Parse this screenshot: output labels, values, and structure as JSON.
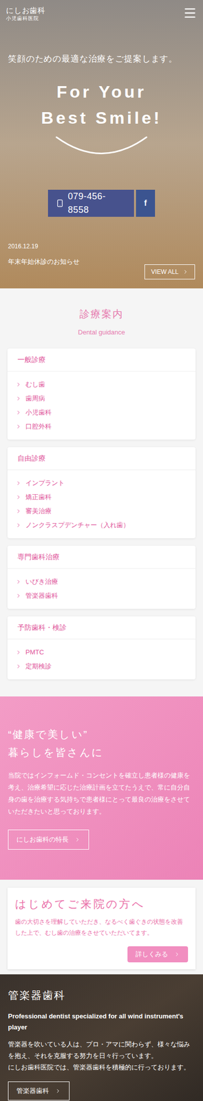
{
  "header": {
    "logo": "にしお歯科",
    "logo_sub": "小児歯科医院"
  },
  "hero": {
    "tagline": "笑顔のための最適な治療をご提案します。",
    "title_lines": [
      "For Your",
      "Best Smile!"
    ],
    "phone": "079-456-8558",
    "facebook": "f"
  },
  "news": {
    "date": "2016.12.19",
    "title": "年末年始休診のお知らせ",
    "button": "VIEW ALL"
  },
  "guidance": {
    "title": "診療案内",
    "subtitle": "Dental guidance",
    "cards": [
      {
        "title": "一般診療",
        "items": [
          "むし歯",
          "歯周病",
          "小児歯科",
          "口腔外科"
        ]
      },
      {
        "title": "自由診療",
        "items": [
          "インプラント",
          "矯正歯科",
          "審美治療",
          "ノンクラスプデンチャー（入れ歯）"
        ]
      },
      {
        "title": "専門歯科治療",
        "items": [
          "いびき治療",
          "管楽器歯科"
        ]
      },
      {
        "title": "予防歯科・検診",
        "items": [
          "PMTC",
          "定期検診"
        ]
      }
    ]
  },
  "feature": {
    "title_lines": [
      "“健康で美しい”",
      "暮らしを皆さんに"
    ],
    "text": "当院ではインフォームド・コンセントを確立し患者様の健康を考え、治療希望に応じた治療計画を立てたうえで、常に自分自身の歯を治療する気持ちで患者様にとって最良の治療をさせていただきたいと思っております。",
    "button": "にしお歯科の特長"
  },
  "first_visit": {
    "title": "はじめてご来院の方へ",
    "text": "歯の大切さを理解していただき、なるべく歯ぐきの状態を改善した上で、むし歯の治療をさせていただいてます。",
    "button": "詳しくみる"
  },
  "wind": {
    "title": "管楽器歯科",
    "subtitle": "Professional dentist specialized for all wind instrument's player",
    "text_lines": [
      "管楽器を吹いている人は、プロ・アマに関わらず、様々な悩みを抱え、それを克服する努力を日々行っています。",
      "にしお歯科医院では、管楽器歯科を積極的に行っております。"
    ],
    "button": "管楽器歯科"
  }
}
